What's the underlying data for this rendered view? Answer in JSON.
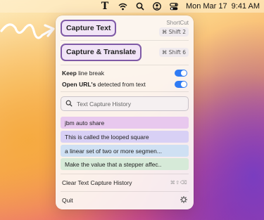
{
  "menubar": {
    "app_icon": "T",
    "date": "Mon Mar 17",
    "time": "9:41 AM",
    "icons": [
      "wifi-icon",
      "search-icon",
      "user-icon",
      "control-center-icon"
    ]
  },
  "panel": {
    "capture_text": {
      "label": "Capture Text",
      "hint": "ShortCut",
      "shortcut": "⌘ Shift 2"
    },
    "capture_translate": {
      "label": "Capture & Translate",
      "shortcut": "⌘ Shift 6"
    },
    "toggles": [
      {
        "bold": "Keep",
        "rest": " line break",
        "on": true
      },
      {
        "bold": "Open URL's",
        "rest": " detected from text",
        "on": true
      }
    ],
    "search": {
      "placeholder": "Text Capture History"
    },
    "history": [
      {
        "text": "jbm auto share",
        "color": "#e8c8ee"
      },
      {
        "text": "This is called the looped square",
        "color": "#d8d0f5"
      },
      {
        "text": "a linear set of two or more segmen...",
        "color": "#cfe0f3"
      },
      {
        "text": "Make the value that a stepper affec..",
        "color": "#d6ead8"
      }
    ],
    "clear": {
      "label": "Clear Text Capture History",
      "shortcut": "⌘⇧⌫"
    },
    "quit": {
      "label": "Quit",
      "icon": "gear-icon"
    }
  },
  "colors": {
    "accent": "#2f7bf4",
    "button_border": "#7f5aa6",
    "button_fill": "#f1e4f6"
  }
}
